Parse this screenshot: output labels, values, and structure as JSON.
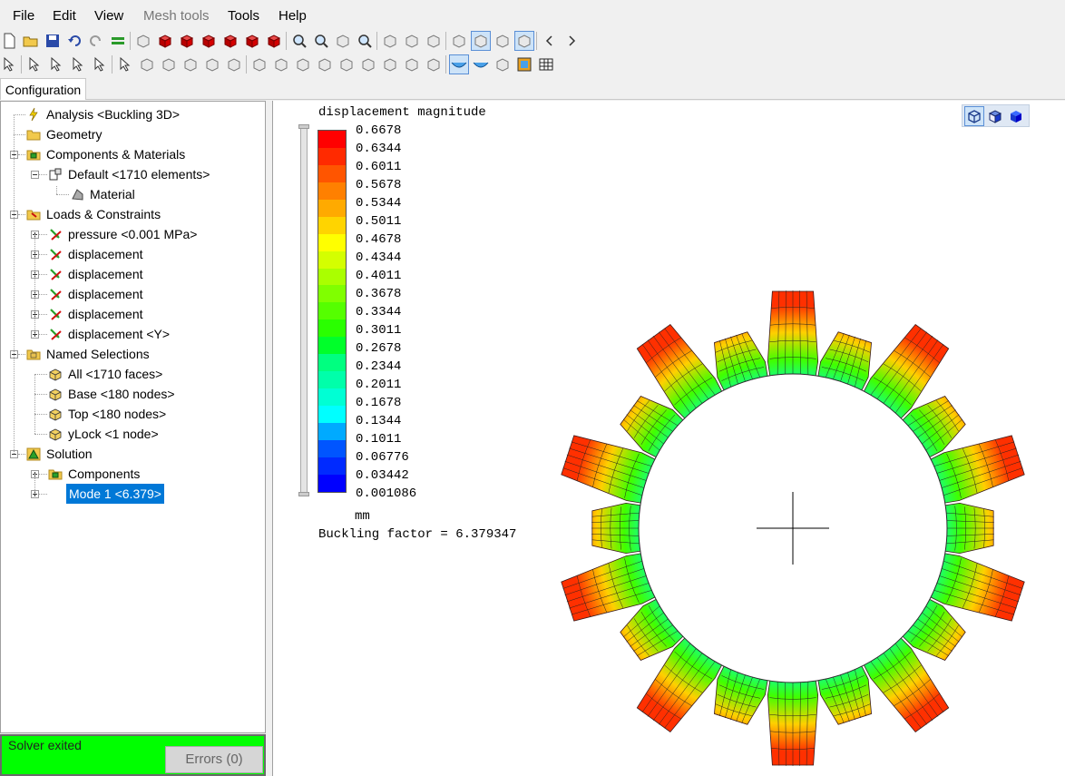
{
  "menu": {
    "file": "File",
    "edit": "Edit",
    "view": "View",
    "mesh_tools": "Mesh tools",
    "tools": "Tools",
    "help": "Help"
  },
  "tabs": {
    "configuration": "Configuration"
  },
  "tree": {
    "analysis": "Analysis <Buckling 3D>",
    "geometry": "Geometry",
    "components_materials": "Components & Materials",
    "default": "Default <1710 elements>",
    "material": "Material",
    "loads_constraints": "Loads & Constraints",
    "pressure": "pressure <0.001 MPa>",
    "displacement_1": "displacement",
    "displacement_2": "displacement",
    "displacement_3": "displacement",
    "displacement_4": "displacement",
    "displacement_y": "displacement <Y>",
    "named_selections": "Named Selections",
    "all": "All <1710 faces>",
    "base": "Base <180 nodes>",
    "top": "Top <180 nodes>",
    "ylock": "yLock <1 node>",
    "solution": "Solution",
    "components": "Components",
    "mode1": "Mode 1 <6.379>"
  },
  "status": {
    "text": "Solver exited",
    "errors_button": "Errors (0)",
    "color": "#00ff00"
  },
  "viewport": {
    "legend_title": "displacement magnitude",
    "legend_values": [
      "0.6678",
      "0.6344",
      "0.6011",
      "0.5678",
      "0.5344",
      "0.5011",
      "0.4678",
      "0.4344",
      "0.4011",
      "0.3678",
      "0.3344",
      "0.3011",
      "0.2678",
      "0.2344",
      "0.2011",
      "0.1678",
      "0.1344",
      "0.1011",
      "0.06776",
      "0.03442",
      "0.001086"
    ],
    "legend_colors": [
      "#ff0000",
      "#ff2a00",
      "#ff5500",
      "#ff8000",
      "#ffaa00",
      "#ffd400",
      "#ffff00",
      "#d4ff00",
      "#aaff00",
      "#80ff00",
      "#55ff00",
      "#2aff00",
      "#00ff2a",
      "#00ff80",
      "#00ffaa",
      "#00ffd4",
      "#00ffff",
      "#00aaff",
      "#0055ff",
      "#002aff",
      "#0000ff"
    ],
    "units": "mm",
    "buckling_factor": "Buckling factor = 6.379347",
    "model_lobes": 20
  },
  "icons": {
    "toolbar_row1": [
      "new-file-icon",
      "open-folder-icon",
      "save-icon",
      "undo-icon",
      "redo-icon",
      "equal-icon",
      "wireframe-cube-icon",
      "red-cube-icon",
      "red-cube-front-icon",
      "red-cube-side-icon",
      "red-cube-top-icon",
      "red-cube-solid-icon",
      "red-cube-dark-icon",
      "zoom-box-icon",
      "magnifier-icon",
      "rotate-icon",
      "zoom-fit-icon",
      "layers-icon",
      "pointer-menu-icon",
      "sketch-icon",
      "plate-icon",
      "shaded-view-icon",
      "hidden-line-icon",
      "grid-view-icon",
      "scroll-left-icon",
      "scroll-right-icon"
    ],
    "toolbar_row2": [
      "select-node-icon",
      "select-element-icon",
      "select-face-icon",
      "select-body-icon",
      "select-star-icon",
      "rectangle-select-icon",
      "cube-outline-icon",
      "delete-x-icon",
      "mirror-icon",
      "align-icon",
      "move-icon",
      "copy-icon",
      "cylinder-icon",
      "arch-icon",
      "curve-icon",
      "y-split-icon",
      "dots-icon",
      "scale-icon",
      "triangle-icon",
      "triangle-outline-icon",
      "mode-shape-icon",
      "deformed-shape-icon",
      "animation-icon",
      "filmstrip-icon",
      "table-icon"
    ]
  }
}
